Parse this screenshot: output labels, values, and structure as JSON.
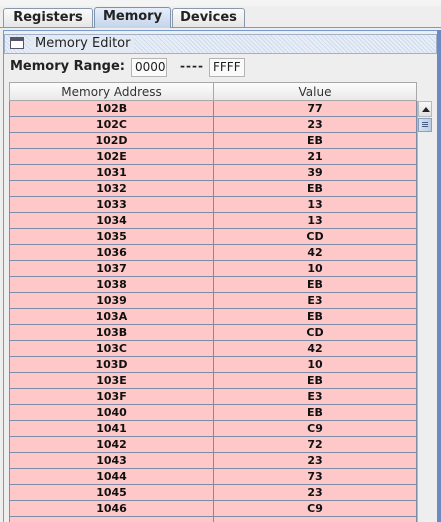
{
  "tabs": [
    {
      "label": "Registers",
      "selected": false
    },
    {
      "label": "Memory",
      "selected": true
    },
    {
      "label": "Devices",
      "selected": false
    }
  ],
  "window": {
    "title": "Memory Editor",
    "icon": "window-icon"
  },
  "range": {
    "label": "Memory Range:",
    "start": "0000",
    "separator": "----",
    "end": "FFFF"
  },
  "table": {
    "columns": [
      "Memory Address",
      "Value"
    ],
    "highlight_color": "#ffc8c8",
    "rows": [
      {
        "address": "102B",
        "value": "77"
      },
      {
        "address": "102C",
        "value": "23"
      },
      {
        "address": "102D",
        "value": "EB"
      },
      {
        "address": "102E",
        "value": "21"
      },
      {
        "address": "1031",
        "value": "39"
      },
      {
        "address": "1032",
        "value": "EB"
      },
      {
        "address": "1033",
        "value": "13"
      },
      {
        "address": "1034",
        "value": "13"
      },
      {
        "address": "1035",
        "value": "CD"
      },
      {
        "address": "1036",
        "value": "42"
      },
      {
        "address": "1037",
        "value": "10"
      },
      {
        "address": "1038",
        "value": "EB"
      },
      {
        "address": "1039",
        "value": "E3"
      },
      {
        "address": "103A",
        "value": "EB"
      },
      {
        "address": "103B",
        "value": "CD"
      },
      {
        "address": "103C",
        "value": "42"
      },
      {
        "address": "103D",
        "value": "10"
      },
      {
        "address": "103E",
        "value": "EB"
      },
      {
        "address": "103F",
        "value": "E3"
      },
      {
        "address": "1040",
        "value": "EB"
      },
      {
        "address": "1041",
        "value": "C9"
      },
      {
        "address": "1042",
        "value": "72"
      },
      {
        "address": "1043",
        "value": "23"
      },
      {
        "address": "1044",
        "value": "73"
      },
      {
        "address": "1045",
        "value": "23"
      },
      {
        "address": "1046",
        "value": "C9"
      },
      {
        "address": "",
        "value": ""
      }
    ]
  }
}
